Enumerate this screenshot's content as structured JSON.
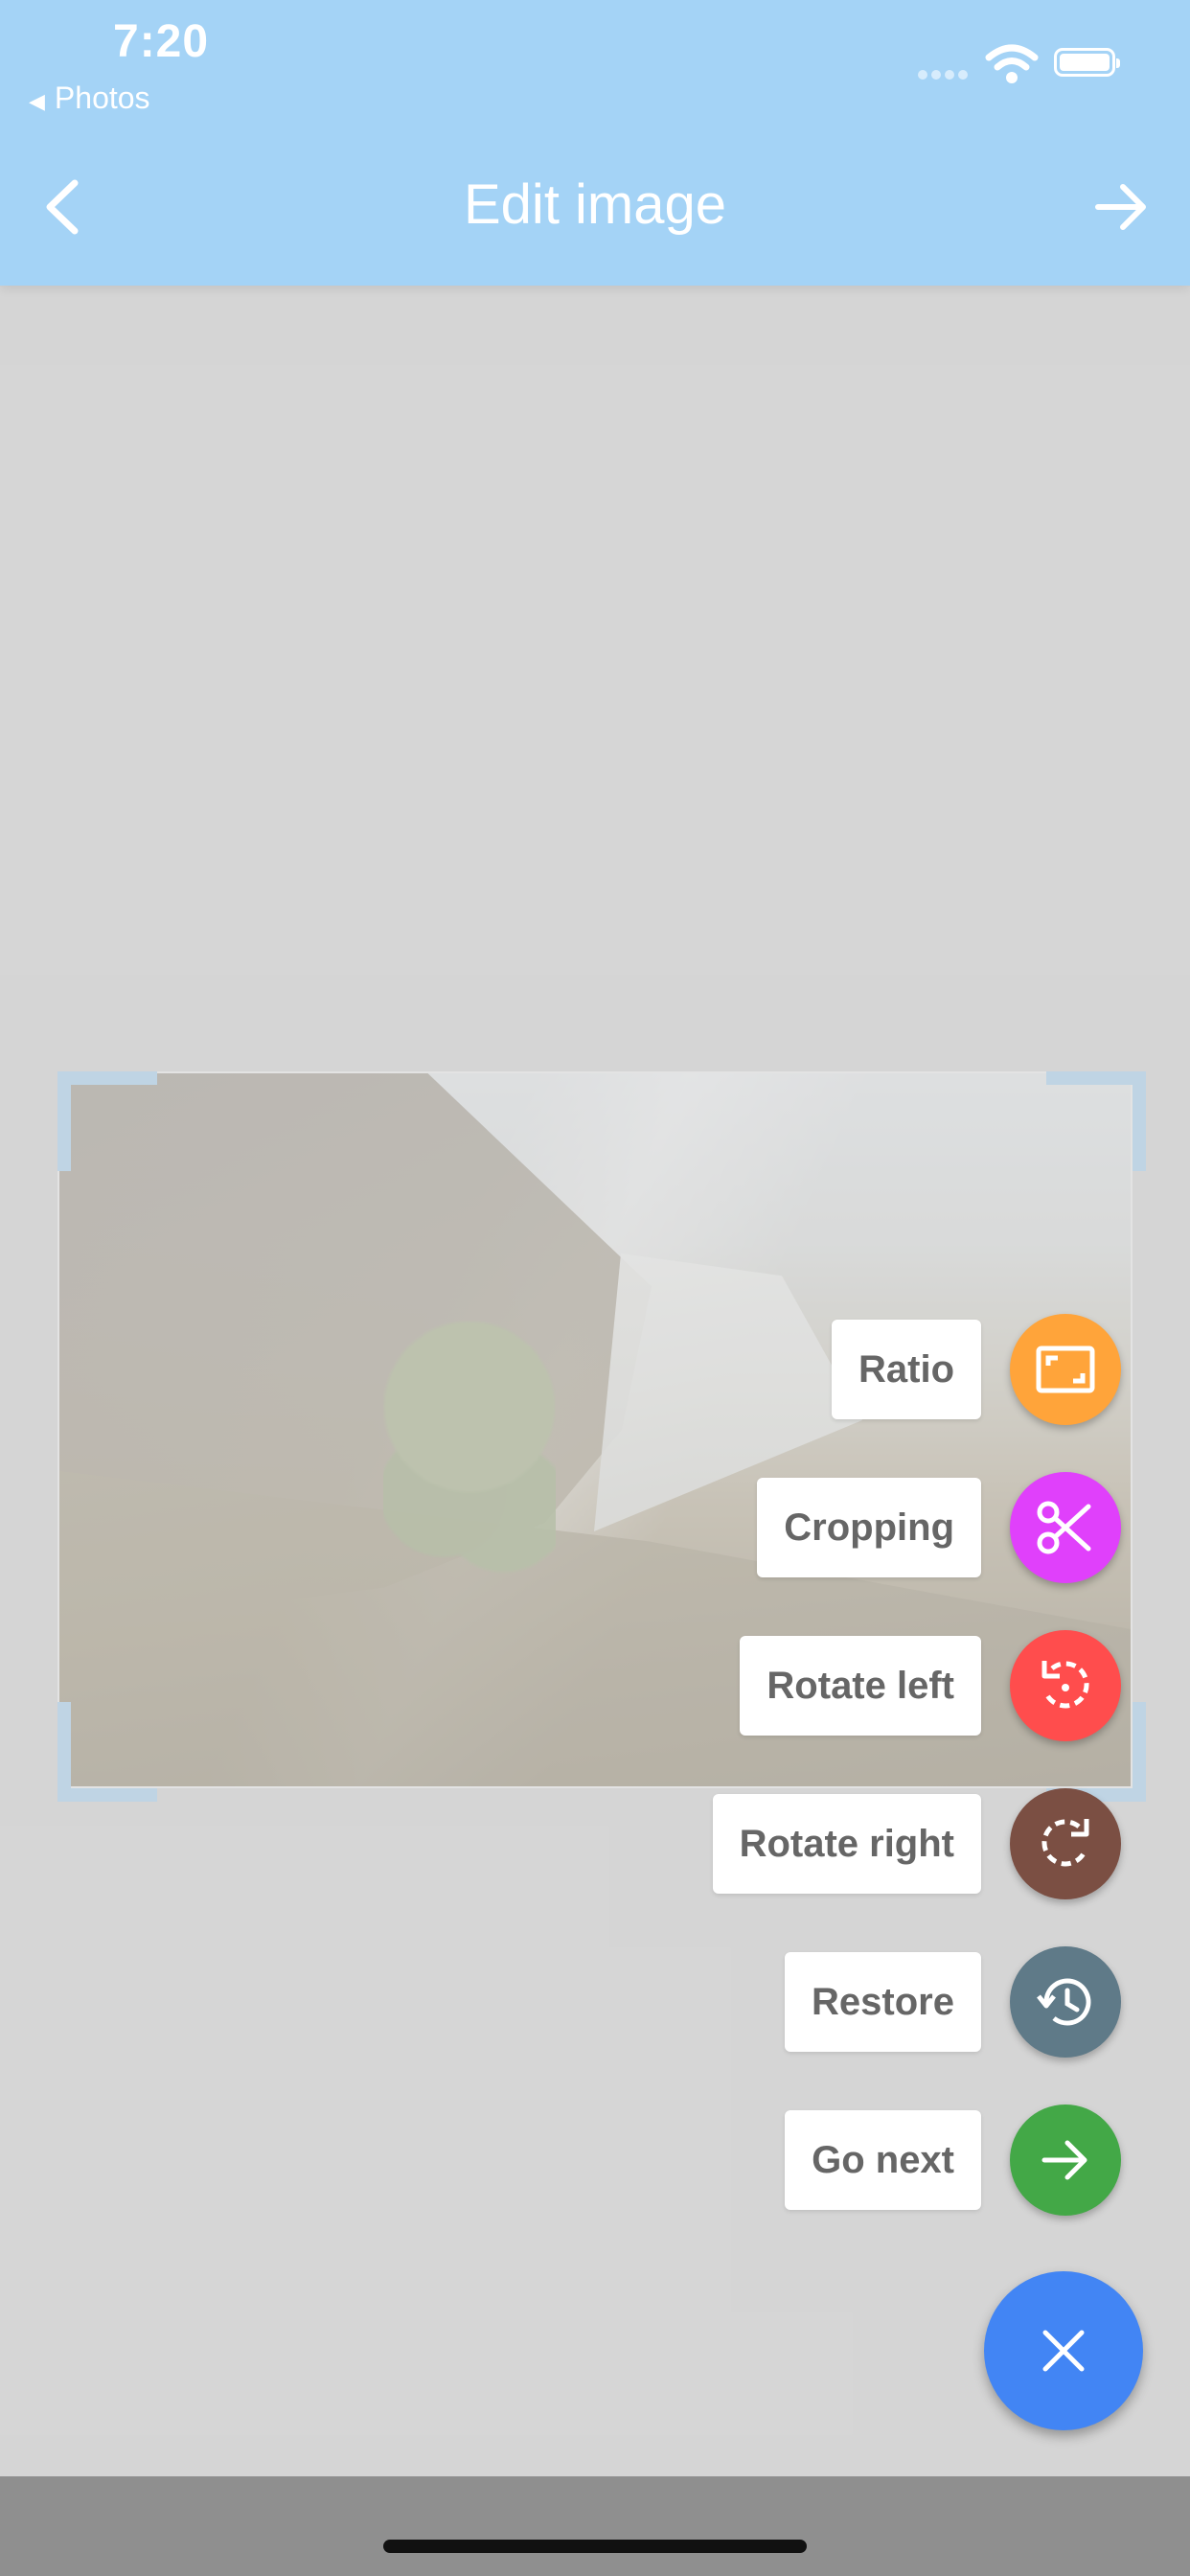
{
  "status_bar": {
    "time": "7:20",
    "back_app_label": "Photos"
  },
  "header": {
    "title": "Edit image",
    "back_icon": "chevron-left-icon",
    "next_icon": "arrow-right-icon",
    "background_color": "#a4d3f6"
  },
  "editor": {
    "image_description_icon": "waterfall-photo",
    "crop_handle_color": "#a4d3f6"
  },
  "speed_dial": {
    "actions": [
      {
        "label": "Ratio",
        "icon": "aspect-ratio-icon",
        "color": "#ffa43a"
      },
      {
        "label": "Cropping",
        "icon": "scissors-icon",
        "color": "#e040fb"
      },
      {
        "label": "Rotate left",
        "icon": "rotate-left-icon",
        "color": "#ff4d4d"
      },
      {
        "label": "Rotate right",
        "icon": "rotate-right-icon",
        "color": "#7b4f43"
      },
      {
        "label": "Restore",
        "icon": "history-icon",
        "color": "#5f7a88"
      },
      {
        "label": "Go next",
        "icon": "arrow-right-icon",
        "color": "#43a847"
      }
    ],
    "main_button_icon": "close-icon",
    "main_button_color": "#4285f4"
  }
}
